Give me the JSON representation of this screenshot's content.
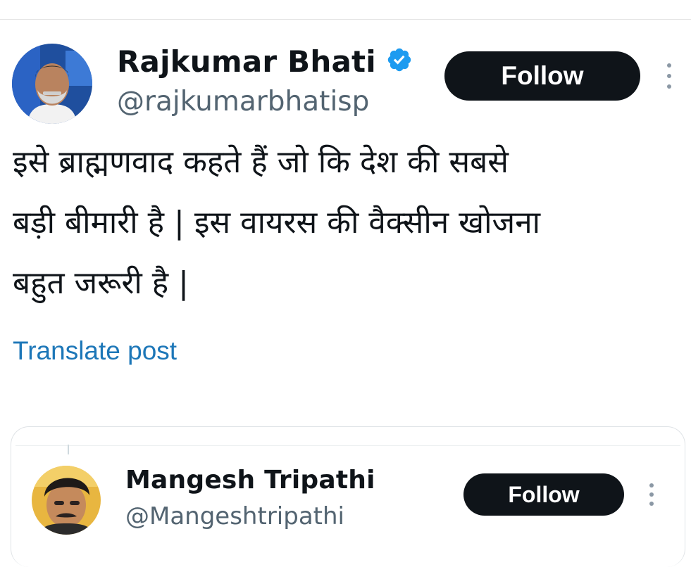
{
  "post": {
    "author_name": "Rajkumar Bhati",
    "author_handle": "@rajkumarbhatisp",
    "verified_icon": "verified-badge-icon",
    "follow_label": "Follow",
    "text": "इसे ब्राह्मणवाद कहते हैं जो कि देश की सबसे\nबड़ी बीमारी है | इस वायरस की वैक्सीन खोजना\nबहुत जरूरी है |",
    "translate_label": "Translate post"
  },
  "reply": {
    "author_name": "Mangesh Tripathi",
    "author_handle": "@Mangeshtripathi",
    "follow_label": "Follow"
  },
  "colors": {
    "follow_bg": "#0f1419",
    "verified": "#1d9bf0",
    "link": "#1d77b8",
    "handle": "#536471"
  }
}
